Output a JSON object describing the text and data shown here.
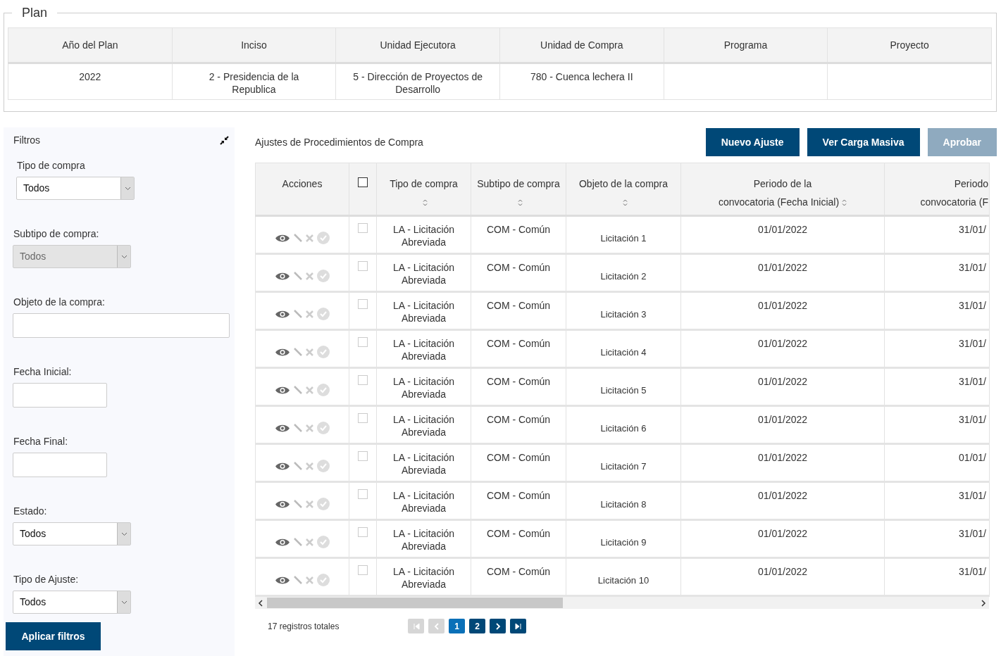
{
  "plan": {
    "legend": "Plan",
    "columns": [
      "Año del Plan",
      "Inciso",
      "Unidad Ejecutora",
      "Unidad de Compra",
      "Programa",
      "Proyecto"
    ],
    "row": [
      "2022",
      "2 - Presidencia de la Republica",
      "5 - Dirección de Proyectos de Desarrollo",
      "780 - Cuenca lechera II"
    ]
  },
  "filters": {
    "title": "Filtros",
    "fields": [
      {
        "kind": "select",
        "label": "Tipo de compra",
        "value": "Todos",
        "disabled": false
      },
      {
        "kind": "select",
        "label": "Subtipo de compra:",
        "value": "Todos",
        "disabled": true
      },
      {
        "kind": "text",
        "label": "Objeto de la compra:"
      },
      {
        "kind": "date",
        "label": "Fecha Inicial:"
      },
      {
        "kind": "date",
        "label": "Fecha Final:"
      },
      {
        "kind": "select",
        "label": "Estado:",
        "value": "Todos",
        "disabled": false
      },
      {
        "kind": "select",
        "label": "Tipo de Ajuste:",
        "value": "Todos",
        "disabled": false
      }
    ],
    "apply": "Aplicar filtros"
  },
  "main": {
    "title": "Ajustes de Procedimientos de Compra",
    "buttons": [
      {
        "label": "Nuevo Ajuste",
        "disabled": false
      },
      {
        "label": "Ver Carga Masiva",
        "disabled": false
      },
      {
        "label": "Aprobar",
        "disabled": true
      }
    ],
    "columns": [
      {
        "kind": "text",
        "lines": [
          "Acciones"
        ],
        "sortable": false
      },
      {
        "kind": "check",
        "checked": false
      },
      {
        "kind": "text",
        "lines": [
          "Tipo de compra"
        ],
        "sortable": true
      },
      {
        "kind": "text",
        "lines": [
          "Subtipo de compra"
        ],
        "sortable": true
      },
      {
        "kind": "text",
        "lines": [
          "Objeto de la compra"
        ],
        "sortable": true
      },
      {
        "kind": "text",
        "lines": [
          "Periodo de la",
          "convocatoria (Fecha Inicial)"
        ],
        "sortable": true
      },
      {
        "kind": "cut",
        "lines": [
          "Periodo",
          "convocatoria (F"
        ],
        "sortable": false
      }
    ],
    "rows": [
      {
        "checked": false,
        "tipo": "LA - Licitación Abreviada",
        "subtipo": "COM - Común",
        "objeto": "Licitación 1",
        "inicio": "01/01/2022",
        "fin": "31/01/"
      },
      {
        "checked": false,
        "tipo": "LA - Licitación Abreviada",
        "subtipo": "COM - Común",
        "objeto": "Licitación 2",
        "inicio": "01/01/2022",
        "fin": "31/01/"
      },
      {
        "checked": false,
        "tipo": "LA - Licitación Abreviada",
        "subtipo": "COM - Común",
        "objeto": "Licitación 3",
        "inicio": "01/01/2022",
        "fin": "31/01/"
      },
      {
        "checked": false,
        "tipo": "LA - Licitación Abreviada",
        "subtipo": "COM - Común",
        "objeto": "Licitación 4",
        "inicio": "01/01/2022",
        "fin": "31/01/"
      },
      {
        "checked": false,
        "tipo": "LA - Licitación Abreviada",
        "subtipo": "COM - Común",
        "objeto": "Licitación 5",
        "inicio": "01/01/2022",
        "fin": "31/01/"
      },
      {
        "checked": false,
        "tipo": "LA - Licitación Abreviada",
        "subtipo": "COM - Común",
        "objeto": "Licitación 6",
        "inicio": "01/01/2022",
        "fin": "31/01/"
      },
      {
        "checked": false,
        "tipo": "LA - Licitación Abreviada",
        "subtipo": "COM - Común",
        "objeto": "Licitación 7",
        "inicio": "01/01/2022",
        "fin": "01/01/"
      },
      {
        "checked": false,
        "tipo": "LA - Licitación Abreviada",
        "subtipo": "COM - Común",
        "objeto": "Licitación 8",
        "inicio": "01/01/2022",
        "fin": "31/01/"
      },
      {
        "checked": false,
        "tipo": "LA - Licitación Abreviada",
        "subtipo": "COM - Común",
        "objeto": "Licitación 9",
        "inicio": "01/01/2022",
        "fin": "31/01/"
      },
      {
        "checked": false,
        "tipo": "LA - Licitación Abreviada",
        "subtipo": "COM - Común",
        "objeto": "Licitación 10",
        "inicio": "01/01/2022",
        "fin": "31/01/"
      }
    ],
    "total": "17 registros totales",
    "pager": [
      {
        "kind": "first",
        "disabled": true
      },
      {
        "kind": "prev",
        "disabled": true
      },
      {
        "kind": "page",
        "label": "1",
        "selected": true
      },
      {
        "kind": "page",
        "label": "2",
        "selected": false
      },
      {
        "kind": "next",
        "disabled": false
      },
      {
        "kind": "last",
        "disabled": false
      }
    ]
  }
}
